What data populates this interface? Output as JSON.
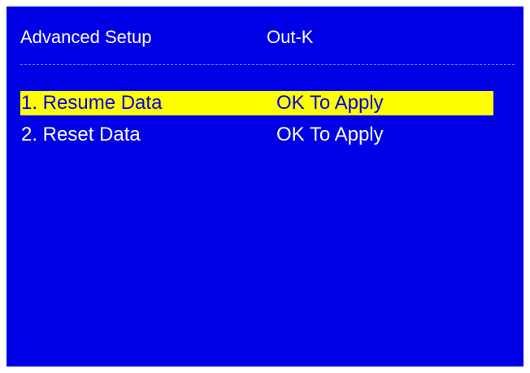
{
  "header": {
    "title": "Advanced Setup",
    "mode": "Out-K"
  },
  "menu": {
    "items": [
      {
        "label": "1. Resume Data",
        "action": "OK To Apply",
        "selected": true
      },
      {
        "label": "2. Reset Data",
        "action": "OK To Apply",
        "selected": false
      }
    ]
  },
  "colors": {
    "background": "#0000e6",
    "text": "#ffffff",
    "highlight": "#ffff00",
    "highlight_text": "#0000e6"
  }
}
